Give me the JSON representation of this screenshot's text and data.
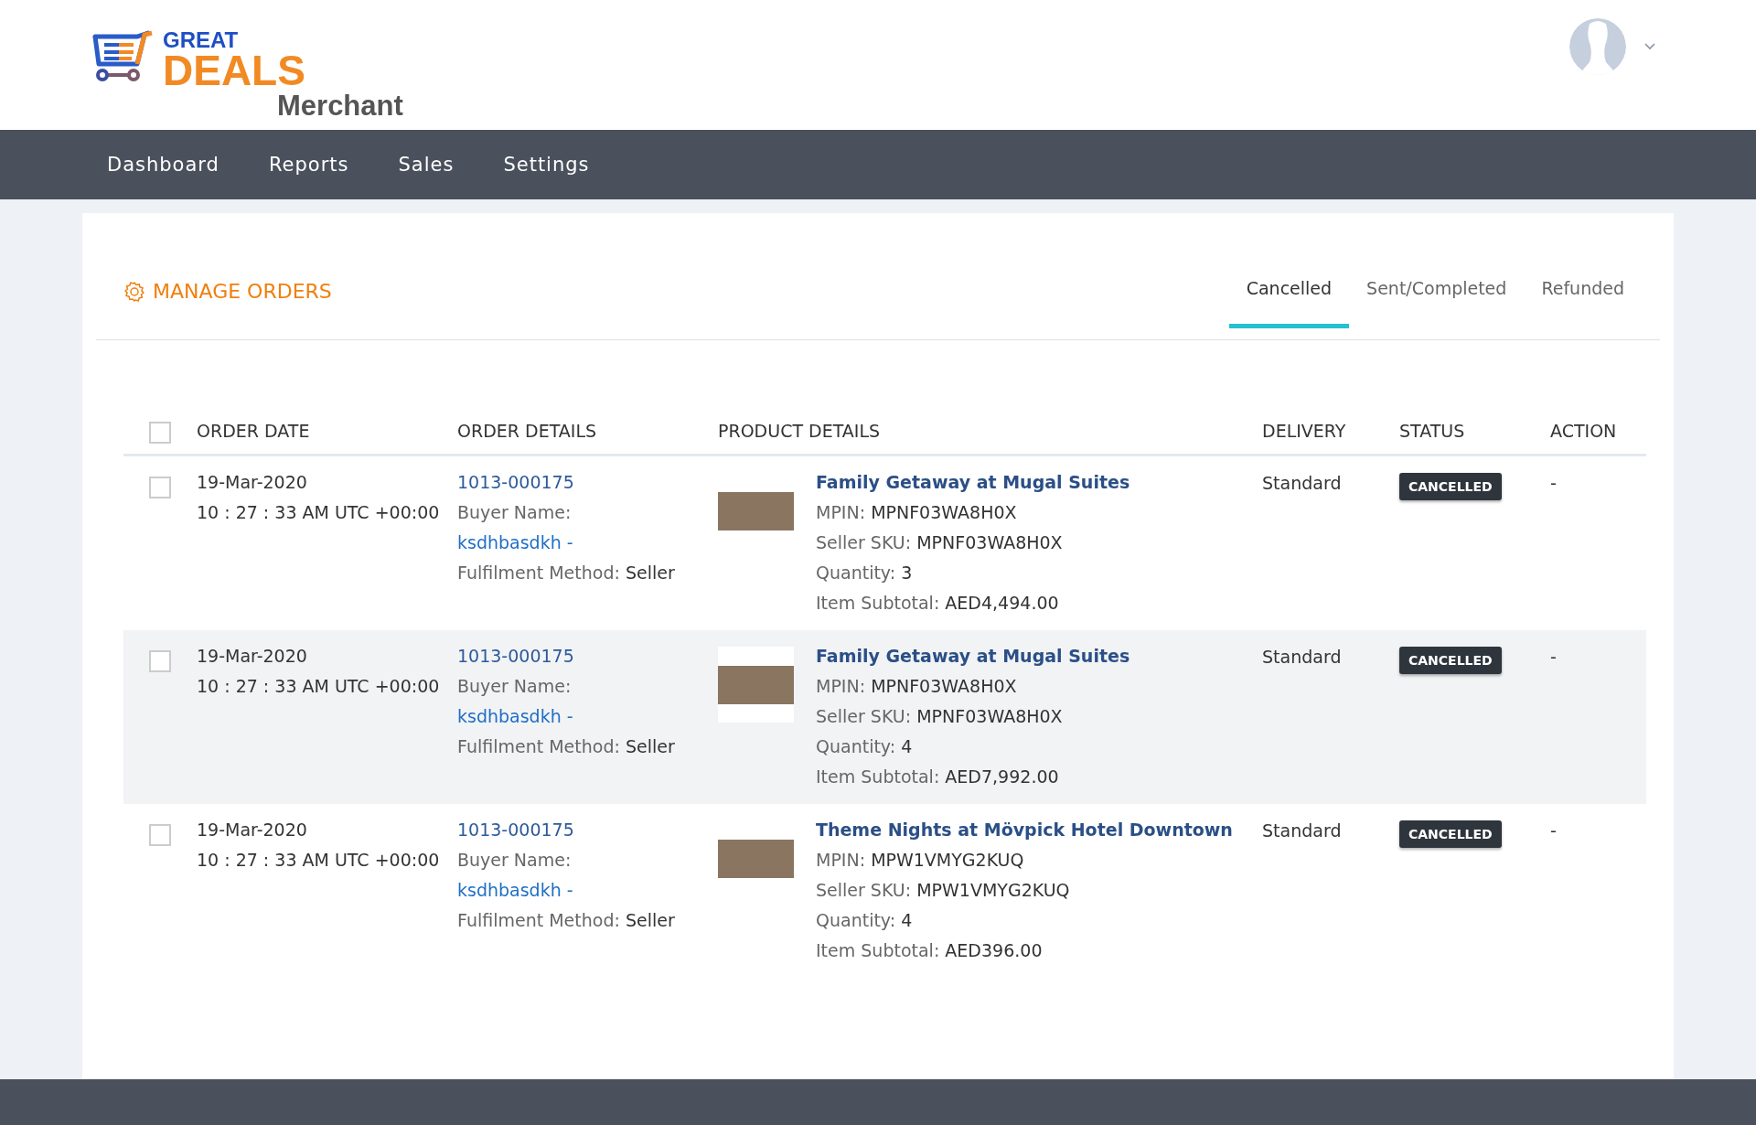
{
  "logo": {
    "line1": "GREAT",
    "line2": "DEALS",
    "line3": "Merchant"
  },
  "nav": [
    {
      "label": "Dashboard"
    },
    {
      "label": "Reports"
    },
    {
      "label": "Sales"
    },
    {
      "label": "Settings"
    }
  ],
  "page_title": "MANAGE ORDERS",
  "tabs": [
    {
      "label": "Cancelled",
      "selected": true
    },
    {
      "label": "Sent/Completed",
      "selected": false
    },
    {
      "label": "Refunded",
      "selected": false
    }
  ],
  "table": {
    "select_all_checked": false,
    "columns": [
      "ORDER DATE",
      "ORDER DETAILS",
      "PRODUCT DETAILS",
      "DELIVERY",
      "STATUS",
      "ACTION"
    ],
    "rows": [
      {
        "checked": false,
        "date": "19-Mar-2020",
        "time": "10 : 27 : 33 AM UTC +00:00",
        "order_id": "1013-000175",
        "buyer_label": "Buyer Name:",
        "buyer": "ksdhbasdkh -",
        "fulfilment_label": "Fulfilment Method:",
        "fulfilment": "Seller",
        "product": "Family Getaway at Mugal Suites",
        "mpin_label": "MPIN:",
        "mpin": "MPNF03WA8H0X",
        "sku_label": "Seller SKU:",
        "sku": "MPNF03WA8H0X",
        "qty_label": "Quantity:",
        "qty": "3",
        "subtotal_label": "Item Subtotal:",
        "subtotal": "AED4,494.00",
        "delivery": "Standard",
        "status": "CANCELLED",
        "action": "-"
      },
      {
        "checked": false,
        "date": "19-Mar-2020",
        "time": "10 : 27 : 33 AM UTC +00:00",
        "order_id": "1013-000175",
        "buyer_label": "Buyer Name:",
        "buyer": "ksdhbasdkh -",
        "fulfilment_label": "Fulfilment Method:",
        "fulfilment": "Seller",
        "product": "Family Getaway at Mugal Suites",
        "mpin_label": "MPIN:",
        "mpin": "MPNF03WA8H0X",
        "sku_label": "Seller SKU:",
        "sku": "MPNF03WA8H0X",
        "qty_label": "Quantity:",
        "qty": "4",
        "subtotal_label": "Item Subtotal:",
        "subtotal": "AED7,992.00",
        "delivery": "Standard",
        "status": "CANCELLED",
        "action": "-"
      },
      {
        "checked": false,
        "date": "19-Mar-2020",
        "time": "10 : 27 : 33 AM UTC +00:00",
        "order_id": "1013-000175",
        "buyer_label": "Buyer Name:",
        "buyer": "ksdhbasdkh -",
        "fulfilment_label": "Fulfilment Method:",
        "fulfilment": "Seller",
        "product": "Theme Nights at Mövpick Hotel Downtown",
        "mpin_label": "MPIN:",
        "mpin": "MPW1VMYG2KUQ",
        "sku_label": "Seller SKU:",
        "sku": "MPW1VMYG2KUQ",
        "qty_label": "Quantity:",
        "qty": "4",
        "subtotal_label": "Item Subtotal:",
        "subtotal": "AED396.00",
        "delivery": "Standard",
        "status": "CANCELLED",
        "action": "-"
      }
    ]
  }
}
